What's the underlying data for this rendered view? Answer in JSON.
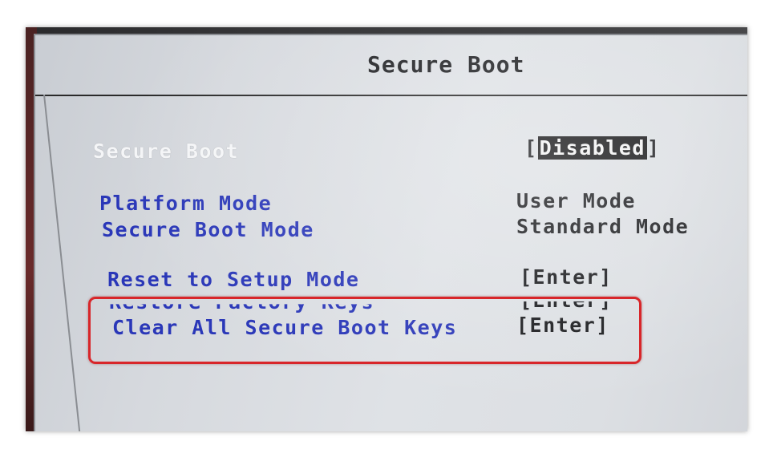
{
  "header": {
    "title": "Secure Boot"
  },
  "settings": {
    "secure_boot": {
      "label": "Secure Boot",
      "value": "Disabled",
      "open": "[",
      "close": "]"
    },
    "platform_mode": {
      "label": "Platform Mode",
      "value": "User Mode"
    },
    "secure_boot_mode": {
      "label": "Secure Boot Mode",
      "value": "Standard Mode"
    },
    "reset_setup": {
      "label": "Reset to Setup Mode",
      "value": "[Enter]"
    },
    "restore_factory": {
      "label": "Restore Factory Keys",
      "value": "[Enter]"
    },
    "clear_keys": {
      "label": "Clear All Secure Boot Keys",
      "value": "[Enter]"
    }
  },
  "colors": {
    "label_blue": "#2a37b8",
    "highlight_red": "#d8262a",
    "screen_bg": "#dcdfe3"
  }
}
